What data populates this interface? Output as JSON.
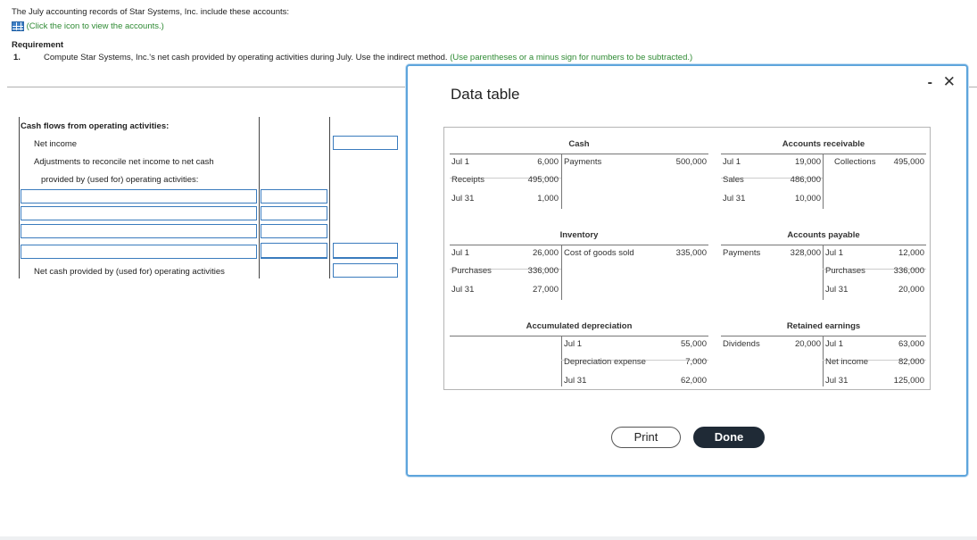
{
  "question": {
    "intro": "The July accounting records of Star Systems, Inc. include these accounts:",
    "link": "(Click the icon to view the accounts.)",
    "requirement_label": "Requirement",
    "req_number": "1.",
    "req_text": "Compute Star Systems, Inc.'s net cash provided by operating activities during July. Use the indirect method.",
    "req_hint": "(Use parentheses or a minus sign for numbers to be subtracted.)"
  },
  "worksheet": {
    "heading": "Cash flows from operating activities:",
    "net_income_label": "Net income",
    "adjustments_label_1": "Adjustments to reconcile net income to net cash",
    "adjustments_label_2": "provided by (used for) operating activities:",
    "net_cash_label": "Net cash provided by (used for) operating activities"
  },
  "modal": {
    "title": "Data table",
    "minimize": "-",
    "close": "✕",
    "print": "Print",
    "done": "Done"
  },
  "accounts": {
    "cash": {
      "title": "Cash",
      "debit_rows": [
        [
          "Jul 1",
          "6,000"
        ],
        [
          "Receipts",
          "495,000"
        ],
        [
          "Jul 31",
          "1,000"
        ]
      ],
      "credit_rows": [
        [
          "Payments",
          "500,000"
        ]
      ]
    },
    "accounts_receivable": {
      "title": "Accounts receivable",
      "debit_rows": [
        [
          "Jul 1",
          "19,000"
        ],
        [
          "Sales",
          "486,000"
        ],
        [
          "Jul 31",
          "10,000"
        ]
      ],
      "credit_rows": [
        [
          "Collections",
          "495,000"
        ]
      ]
    },
    "inventory": {
      "title": "Inventory",
      "debit_rows": [
        [
          "Jul 1",
          "26,000"
        ],
        [
          "Purchases",
          "336,000"
        ],
        [
          "Jul 31",
          "27,000"
        ]
      ],
      "credit_rows": [
        [
          "Cost of goods sold",
          "335,000"
        ]
      ]
    },
    "accounts_payable": {
      "title": "Accounts payable",
      "debit_rows": [
        [
          "Payments",
          "328,000"
        ]
      ],
      "credit_rows": [
        [
          "Jul 1",
          "12,000"
        ],
        [
          "Purchases",
          "336,000"
        ],
        [
          "Jul 31",
          "20,000"
        ]
      ]
    },
    "accumulated_depreciation": {
      "title": "Accumulated depreciation",
      "debit_rows": [],
      "credit_rows": [
        [
          "Jul 1",
          "55,000"
        ],
        [
          "Depreciation expense",
          "7,000"
        ],
        [
          "Jul 31",
          "62,000"
        ]
      ]
    },
    "retained_earnings": {
      "title": "Retained earnings",
      "debit_rows": [
        [
          "Dividends",
          "20,000"
        ]
      ],
      "credit_rows": [
        [
          "Jul 1",
          "63,000"
        ],
        [
          "Net income",
          "82,000"
        ],
        [
          "Jul 31",
          "125,000"
        ]
      ]
    }
  }
}
